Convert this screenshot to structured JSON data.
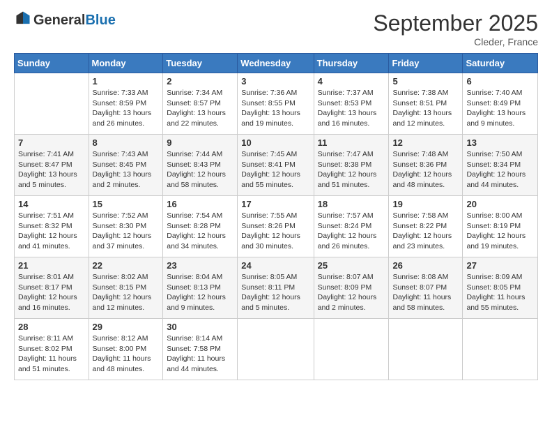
{
  "header": {
    "logo_general": "General",
    "logo_blue": "Blue",
    "month_year": "September 2025",
    "location": "Cleder, France"
  },
  "days_of_week": [
    "Sunday",
    "Monday",
    "Tuesday",
    "Wednesday",
    "Thursday",
    "Friday",
    "Saturday"
  ],
  "weeks": [
    [
      {
        "day": "",
        "sunrise": "",
        "sunset": "",
        "daylight": ""
      },
      {
        "day": "1",
        "sunrise": "Sunrise: 7:33 AM",
        "sunset": "Sunset: 8:59 PM",
        "daylight": "Daylight: 13 hours and 26 minutes."
      },
      {
        "day": "2",
        "sunrise": "Sunrise: 7:34 AM",
        "sunset": "Sunset: 8:57 PM",
        "daylight": "Daylight: 13 hours and 22 minutes."
      },
      {
        "day": "3",
        "sunrise": "Sunrise: 7:36 AM",
        "sunset": "Sunset: 8:55 PM",
        "daylight": "Daylight: 13 hours and 19 minutes."
      },
      {
        "day": "4",
        "sunrise": "Sunrise: 7:37 AM",
        "sunset": "Sunset: 8:53 PM",
        "daylight": "Daylight: 13 hours and 16 minutes."
      },
      {
        "day": "5",
        "sunrise": "Sunrise: 7:38 AM",
        "sunset": "Sunset: 8:51 PM",
        "daylight": "Daylight: 13 hours and 12 minutes."
      },
      {
        "day": "6",
        "sunrise": "Sunrise: 7:40 AM",
        "sunset": "Sunset: 8:49 PM",
        "daylight": "Daylight: 13 hours and 9 minutes."
      }
    ],
    [
      {
        "day": "7",
        "sunrise": "Sunrise: 7:41 AM",
        "sunset": "Sunset: 8:47 PM",
        "daylight": "Daylight: 13 hours and 5 minutes."
      },
      {
        "day": "8",
        "sunrise": "Sunrise: 7:43 AM",
        "sunset": "Sunset: 8:45 PM",
        "daylight": "Daylight: 13 hours and 2 minutes."
      },
      {
        "day": "9",
        "sunrise": "Sunrise: 7:44 AM",
        "sunset": "Sunset: 8:43 PM",
        "daylight": "Daylight: 12 hours and 58 minutes."
      },
      {
        "day": "10",
        "sunrise": "Sunrise: 7:45 AM",
        "sunset": "Sunset: 8:41 PM",
        "daylight": "Daylight: 12 hours and 55 minutes."
      },
      {
        "day": "11",
        "sunrise": "Sunrise: 7:47 AM",
        "sunset": "Sunset: 8:38 PM",
        "daylight": "Daylight: 12 hours and 51 minutes."
      },
      {
        "day": "12",
        "sunrise": "Sunrise: 7:48 AM",
        "sunset": "Sunset: 8:36 PM",
        "daylight": "Daylight: 12 hours and 48 minutes."
      },
      {
        "day": "13",
        "sunrise": "Sunrise: 7:50 AM",
        "sunset": "Sunset: 8:34 PM",
        "daylight": "Daylight: 12 hours and 44 minutes."
      }
    ],
    [
      {
        "day": "14",
        "sunrise": "Sunrise: 7:51 AM",
        "sunset": "Sunset: 8:32 PM",
        "daylight": "Daylight: 12 hours and 41 minutes."
      },
      {
        "day": "15",
        "sunrise": "Sunrise: 7:52 AM",
        "sunset": "Sunset: 8:30 PM",
        "daylight": "Daylight: 12 hours and 37 minutes."
      },
      {
        "day": "16",
        "sunrise": "Sunrise: 7:54 AM",
        "sunset": "Sunset: 8:28 PM",
        "daylight": "Daylight: 12 hours and 34 minutes."
      },
      {
        "day": "17",
        "sunrise": "Sunrise: 7:55 AM",
        "sunset": "Sunset: 8:26 PM",
        "daylight": "Daylight: 12 hours and 30 minutes."
      },
      {
        "day": "18",
        "sunrise": "Sunrise: 7:57 AM",
        "sunset": "Sunset: 8:24 PM",
        "daylight": "Daylight: 12 hours and 26 minutes."
      },
      {
        "day": "19",
        "sunrise": "Sunrise: 7:58 AM",
        "sunset": "Sunset: 8:22 PM",
        "daylight": "Daylight: 12 hours and 23 minutes."
      },
      {
        "day": "20",
        "sunrise": "Sunrise: 8:00 AM",
        "sunset": "Sunset: 8:19 PM",
        "daylight": "Daylight: 12 hours and 19 minutes."
      }
    ],
    [
      {
        "day": "21",
        "sunrise": "Sunrise: 8:01 AM",
        "sunset": "Sunset: 8:17 PM",
        "daylight": "Daylight: 12 hours and 16 minutes."
      },
      {
        "day": "22",
        "sunrise": "Sunrise: 8:02 AM",
        "sunset": "Sunset: 8:15 PM",
        "daylight": "Daylight: 12 hours and 12 minutes."
      },
      {
        "day": "23",
        "sunrise": "Sunrise: 8:04 AM",
        "sunset": "Sunset: 8:13 PM",
        "daylight": "Daylight: 12 hours and 9 minutes."
      },
      {
        "day": "24",
        "sunrise": "Sunrise: 8:05 AM",
        "sunset": "Sunset: 8:11 PM",
        "daylight": "Daylight: 12 hours and 5 minutes."
      },
      {
        "day": "25",
        "sunrise": "Sunrise: 8:07 AM",
        "sunset": "Sunset: 8:09 PM",
        "daylight": "Daylight: 12 hours and 2 minutes."
      },
      {
        "day": "26",
        "sunrise": "Sunrise: 8:08 AM",
        "sunset": "Sunset: 8:07 PM",
        "daylight": "Daylight: 11 hours and 58 minutes."
      },
      {
        "day": "27",
        "sunrise": "Sunrise: 8:09 AM",
        "sunset": "Sunset: 8:05 PM",
        "daylight": "Daylight: 11 hours and 55 minutes."
      }
    ],
    [
      {
        "day": "28",
        "sunrise": "Sunrise: 8:11 AM",
        "sunset": "Sunset: 8:02 PM",
        "daylight": "Daylight: 11 hours and 51 minutes."
      },
      {
        "day": "29",
        "sunrise": "Sunrise: 8:12 AM",
        "sunset": "Sunset: 8:00 PM",
        "daylight": "Daylight: 11 hours and 48 minutes."
      },
      {
        "day": "30",
        "sunrise": "Sunrise: 8:14 AM",
        "sunset": "Sunset: 7:58 PM",
        "daylight": "Daylight: 11 hours and 44 minutes."
      },
      {
        "day": "",
        "sunrise": "",
        "sunset": "",
        "daylight": ""
      },
      {
        "day": "",
        "sunrise": "",
        "sunset": "",
        "daylight": ""
      },
      {
        "day": "",
        "sunrise": "",
        "sunset": "",
        "daylight": ""
      },
      {
        "day": "",
        "sunrise": "",
        "sunset": "",
        "daylight": ""
      }
    ]
  ]
}
